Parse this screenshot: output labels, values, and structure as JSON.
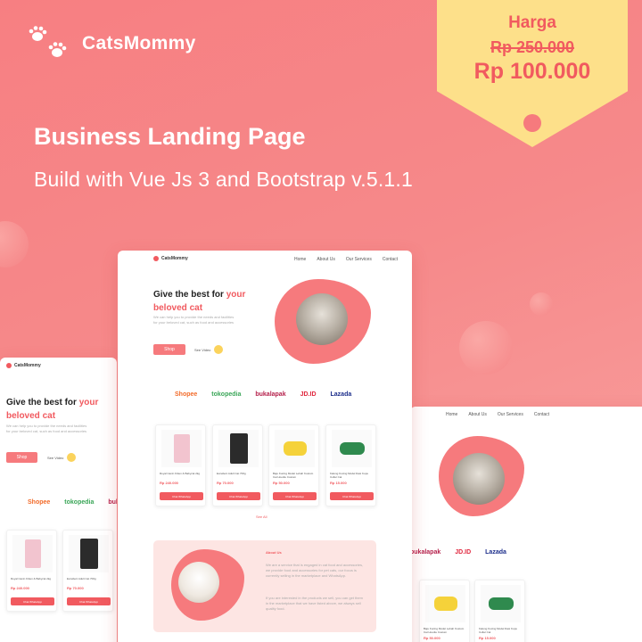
{
  "brand": {
    "name": "CatsMommy",
    "icon": "paw-icon"
  },
  "hero": {
    "title": "Business Landing Page",
    "subtitle": "Build with Vue Js 3 and Bootstrap v.5.1.1"
  },
  "price": {
    "label": "Harga",
    "old": "Rp 250.000",
    "new": "Rp 100.000"
  },
  "mock": {
    "logo": "CatsMommy",
    "nav": [
      "Home",
      "About Us",
      "Our Services",
      "Contact"
    ],
    "headline_part1": "Give the best for ",
    "headline_highlight1": "your",
    "headline_highlight2": "beloved cat",
    "description": "We can help you to provide the needs and facilities for your beloved cat, such as food and accessories",
    "shop_label": "Shop",
    "video_label": "See Video",
    "partners": [
      "Shopee",
      "tokopedia",
      "bukalapak",
      "JD.ID",
      "Lazada"
    ],
    "products": [
      {
        "name": "Royal Canin Kitten & Babycat 2kg",
        "price": "Rp 240.000",
        "button": "Chat WhatsApp"
      },
      {
        "name": "Excellent Adult Cat 700g",
        "price": "Rp 70.000",
        "button": "Chat WhatsApp"
      },
      {
        "name": "Baju Kucing Model Lebah Kostum Cat Hoodie Costum",
        "price": "Rp 50.000",
        "button": "Chat WhatsApp"
      },
      {
        "name": "Kalung Kucing Model Dasi Kupu Collar Cat",
        "price": "Rp 15.000",
        "button": "Chat WhatsApp"
      }
    ],
    "see_all": "See All",
    "about_title": "About Us",
    "about_text1": "We are a service that is engaged in cat food and accessories, we provide food and accessories for pet cats, our focus is currently selling in the marketplace and WhatsApp.",
    "about_text2": "If you are interested in the products we sell, you can get them in the marketplace that we have listed above, we always sell quality food."
  },
  "colors": {
    "accent": "#f15a5f",
    "tag": "#fde08a",
    "background": "#f77f82"
  }
}
